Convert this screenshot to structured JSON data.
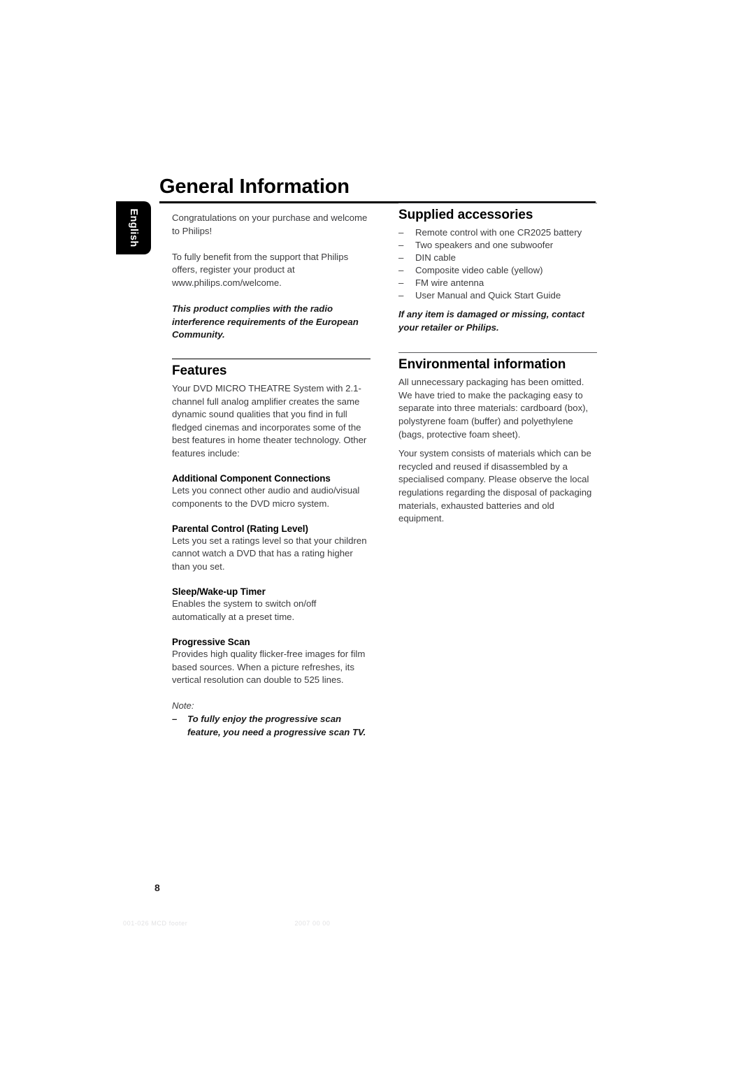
{
  "document": {
    "title": "General Information",
    "page_number": "8",
    "language_tab": "English"
  },
  "left_column": {
    "intro_paragraph_1": "Congratulations on your purchase and welcome to Philips!",
    "intro_paragraph_2": "To fully benefit from the support that Philips offers, register your product at www.philips.com/welcome.",
    "compliance_note": "This product complies with the radio interference requirements of the European Community.",
    "features": {
      "heading": "Features",
      "intro": "Your DVD MICRO THEATRE System  with 2.1-channel full analog amplifier creates the same dynamic sound qualities that you find in full fledged cinemas and incorporates some of the best features in home theater technology. Other features include:",
      "items": [
        {
          "title": "Additional Component Connections",
          "text": "Lets you connect other audio and audio/visual components to the DVD micro system."
        },
        {
          "title": "Parental Control (Rating Level)",
          "text": "Lets you set a ratings level so that your children cannot watch a DVD that has a rating higher than you set."
        },
        {
          "title": "Sleep/Wake-up Timer",
          "text": "Enables the system to switch on/off automatically at a preset time."
        },
        {
          "title": "Progressive Scan",
          "text": "Provides high quality flicker-free images for film based sources. When a picture refreshes, its vertical resolution can double to 525 lines."
        }
      ],
      "note_label": "Note:",
      "note_dash": "–",
      "note_text": "To fully enjoy the progressive scan feature, you need a progressive scan TV."
    }
  },
  "right_column": {
    "supplied_accessories": {
      "heading": "Supplied accessories",
      "dash": "–",
      "items": [
        "Remote control with one CR2025 battery",
        "Two speakers and one subwoofer",
        "DIN cable",
        "Composite video cable (yellow)",
        "FM wire antenna",
        "User Manual and Quick Start Guide"
      ],
      "footnote": "If any item is damaged or missing, contact your retailer or Philips."
    },
    "environmental_information": {
      "heading": "Environmental information",
      "paragraph_1": "All unnecessary packaging has been omitted. We have tried to make the packaging easy to separate into three materials: cardboard (box), polystyrene foam (buffer) and polyethylene (bags, protective foam sheet).",
      "paragraph_2": "Your system consists of materials which can be recycled and reused if disassembled by a specialised company. Please observe the local regulations regarding the disposal of packaging materials, exhausted batteries and old equipment."
    }
  },
  "footer_artifact": {
    "left": "001-026 MCD footer",
    "right": "2007 00 00"
  }
}
